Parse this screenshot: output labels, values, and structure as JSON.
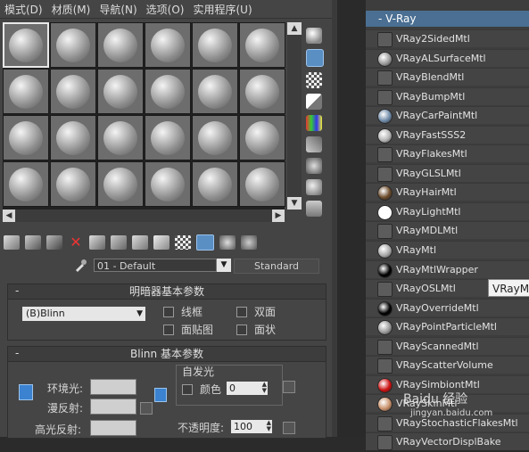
{
  "menu": [
    "模式(D)",
    "材质(M)",
    "导航(N)",
    "选项(O)",
    "实用程序(U)"
  ],
  "editor": {
    "material_name": "01 - Default",
    "material_type": "Standard",
    "shader_rollout_title": "明暗器基本参数",
    "shader_value": "(B)Blinn",
    "options": {
      "wire": "线框",
      "two_sided": "双面",
      "face_map": "面贴图",
      "faceted": "面状"
    },
    "blinn_rollout_title": "Blinn 基本参数",
    "self_illum_title": "自发光",
    "color_label": "颜色",
    "color_value": "0",
    "ambient_label": "环境光:",
    "diffuse_label": "漫反射:",
    "specular_label": "高光反射:",
    "opacity_label": "不透明度:",
    "opacity_value": "100"
  },
  "vray": {
    "group_title": "- V-Ray",
    "materials": [
      {
        "name": "VRay2SidedMtl",
        "icon": "flat-gray",
        "color": "#5c5c5c"
      },
      {
        "name": "VRayALSurfaceMtl",
        "icon": "sphere",
        "color": "#9a9a9a"
      },
      {
        "name": "VRayBlendMtl",
        "icon": "flat-gray",
        "color": "#5c5c5c"
      },
      {
        "name": "VRayBumpMtl",
        "icon": "flat-gray",
        "color": "#5c5c5c"
      },
      {
        "name": "VRayCarPaintMtl",
        "icon": "sphere",
        "color": "#6f8aa8"
      },
      {
        "name": "VRayFastSSS2",
        "icon": "sphere",
        "color": "#b4b4b4"
      },
      {
        "name": "VRayFlakesMtl",
        "icon": "flat-gray",
        "color": "#5c5c5c"
      },
      {
        "name": "VRayGLSLMtl",
        "icon": "flat-gray",
        "color": "#5c5c5c"
      },
      {
        "name": "VRayHairMtl",
        "icon": "sphere",
        "color": "#6b4a2a"
      },
      {
        "name": "VRayLightMtl",
        "icon": "sphere",
        "color": "#ffffff"
      },
      {
        "name": "VRayMDLMtl",
        "icon": "flat-gray",
        "color": "#5c5c5c"
      },
      {
        "name": "VRayMtl",
        "icon": "sphere",
        "color": "#a8a8a8"
      },
      {
        "name": "VRayMtlWrapper",
        "icon": "sphere",
        "color": "#000000"
      },
      {
        "name": "VRayOSLMtl",
        "icon": "flat-gray",
        "color": "#5c5c5c"
      },
      {
        "name": "VRayOverrideMtl",
        "icon": "sphere",
        "color": "#000000"
      },
      {
        "name": "VRayPointParticleMtl",
        "icon": "sphere",
        "color": "#9a9a9a"
      },
      {
        "name": "VRayScannedMtl",
        "icon": "flat-gray",
        "color": "#5c5c5c"
      },
      {
        "name": "VRayScatterVolume",
        "icon": "flat-gray",
        "color": "#5c5c5c"
      },
      {
        "name": "VRaySimbiontMtl",
        "icon": "sphere",
        "color": "#cc1111"
      },
      {
        "name": "VRaySkinMtl",
        "icon": "sphere",
        "color": "#c8906a"
      },
      {
        "name": "VRayStochasticFlakesMtl",
        "icon": "flat-gray",
        "color": "#5c5c5c"
      },
      {
        "name": "VRayVectorDisplBake",
        "icon": "flat-gray",
        "color": "#5c5c5c"
      }
    ],
    "tooltip": "VRayM"
  },
  "watermark": {
    "text": "Baidu 经验",
    "url": "jingyan.baidu.com"
  }
}
